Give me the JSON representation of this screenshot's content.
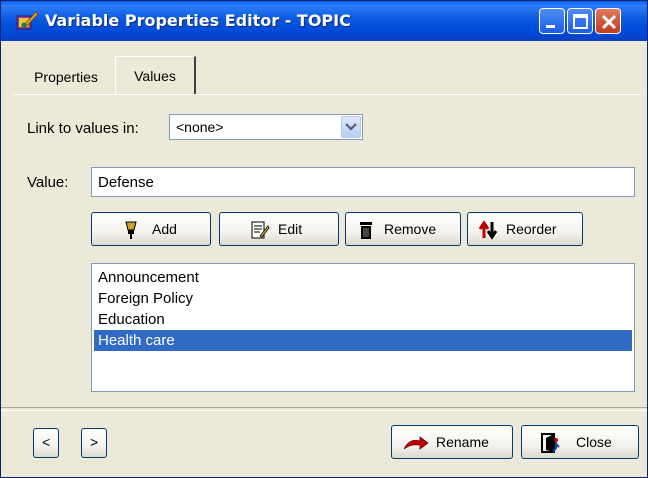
{
  "window": {
    "title": "Variable Properties Editor - TOPIC",
    "icons": {
      "app": "paint-brush-icon",
      "minimize": "minimize-icon",
      "maximize": "maximize-icon",
      "close": "close-icon"
    }
  },
  "tabs": [
    {
      "label": "Properties",
      "active": false
    },
    {
      "label": "Values",
      "active": true
    }
  ],
  "link": {
    "label": "Link to values in:",
    "selected": "<none>"
  },
  "value": {
    "label": "Value:",
    "current": "Defense"
  },
  "actions": {
    "add": {
      "label": "Add",
      "icon": "pen-add-icon"
    },
    "edit": {
      "label": "Edit",
      "icon": "edit-document-icon"
    },
    "remove": {
      "label": "Remove",
      "icon": "trash-icon"
    },
    "reorder": {
      "label": "Reorder",
      "icon": "reorder-arrows-icon"
    }
  },
  "values_list": {
    "items": [
      "Announcement",
      "Foreign Policy",
      "Education",
      "Health care"
    ],
    "selected_index": 3
  },
  "footer": {
    "prev": {
      "label": "<"
    },
    "next": {
      "label": ">"
    },
    "rename": {
      "label": "Rename",
      "icon": "red-arrow-icon"
    },
    "close": {
      "label": "Close",
      "icon": "door-exit-icon"
    }
  },
  "colors": {
    "title_bar": "#0054e3",
    "selection": "#316ac5",
    "dialog_bg": "#ece9d8",
    "close_button": "#c23a1c"
  }
}
